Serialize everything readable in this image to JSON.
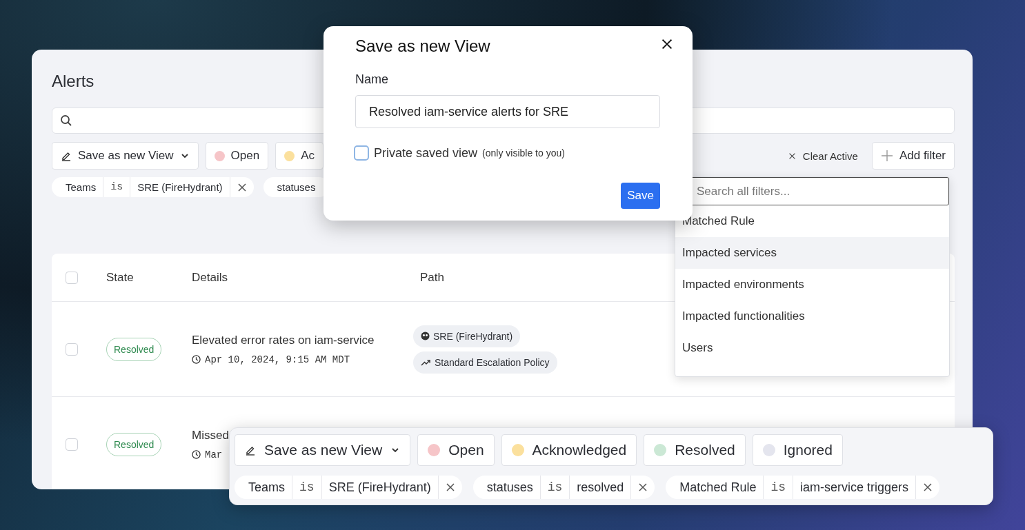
{
  "alerts": {
    "title": "Alerts",
    "toolbar": {
      "save_view": "Save as new View",
      "statuses": [
        {
          "label": "Open",
          "color": "#f6c5c8"
        },
        {
          "label": "Ac",
          "color": "#fbe09d"
        }
      ],
      "clear": "Clear Active",
      "add_filter": "Add filter"
    },
    "filters": [
      {
        "field": "Teams",
        "op": "is",
        "value": "SRE (FireHydrant)"
      },
      {
        "field": "statuses"
      }
    ],
    "table": {
      "select_all": {
        "checked": false
      },
      "columns": [
        "State",
        "Details",
        "Path"
      ],
      "rows": [
        {
          "checked": false,
          "state": "Resolved",
          "title": "Elevated error rates on iam-service",
          "time": "Apr 10, 2024, 9:15 AM MDT",
          "path": [
            {
              "kind": "team",
              "label": "SRE (FireHydrant)"
            },
            {
              "kind": "policy",
              "label": "Standard Escalation Policy"
            }
          ]
        },
        {
          "checked": false,
          "state": "Resolved",
          "title": "Missed",
          "time": "Mar",
          "path": []
        }
      ]
    }
  },
  "modal": {
    "title": "Save as new View",
    "name_label": "Name",
    "name_value": "Resolved iam-service alerts for SRE",
    "private": {
      "label": "Private saved view",
      "hint": "(only visible to you)",
      "checked": false
    },
    "save": "Save"
  },
  "filter_menu": {
    "placeholder": "Search all filters...",
    "items": [
      {
        "label": "Matched Rule",
        "selected": false
      },
      {
        "label": "Impacted services",
        "selected": true
      },
      {
        "label": "Impacted environments",
        "selected": false
      },
      {
        "label": "Impacted functionalities",
        "selected": false
      },
      {
        "label": "Users",
        "selected": false
      }
    ]
  },
  "strip": {
    "save_view": "Save as new View",
    "statuses": [
      {
        "label": "Open",
        "color": "#f6c5c8"
      },
      {
        "label": "Acknowledged",
        "color": "#fbe09d"
      },
      {
        "label": "Resolved",
        "color": "#cbe8d5"
      },
      {
        "label": "Ignored",
        "color": "#e4e5ee"
      }
    ],
    "filters": [
      {
        "field": "Teams",
        "op": "is",
        "value": "SRE (FireHydrant)"
      },
      {
        "field": "statuses",
        "op": "is",
        "value": "resolved"
      },
      {
        "field": "Matched Rule",
        "op": "is",
        "value": "iam-service triggers"
      }
    ]
  }
}
